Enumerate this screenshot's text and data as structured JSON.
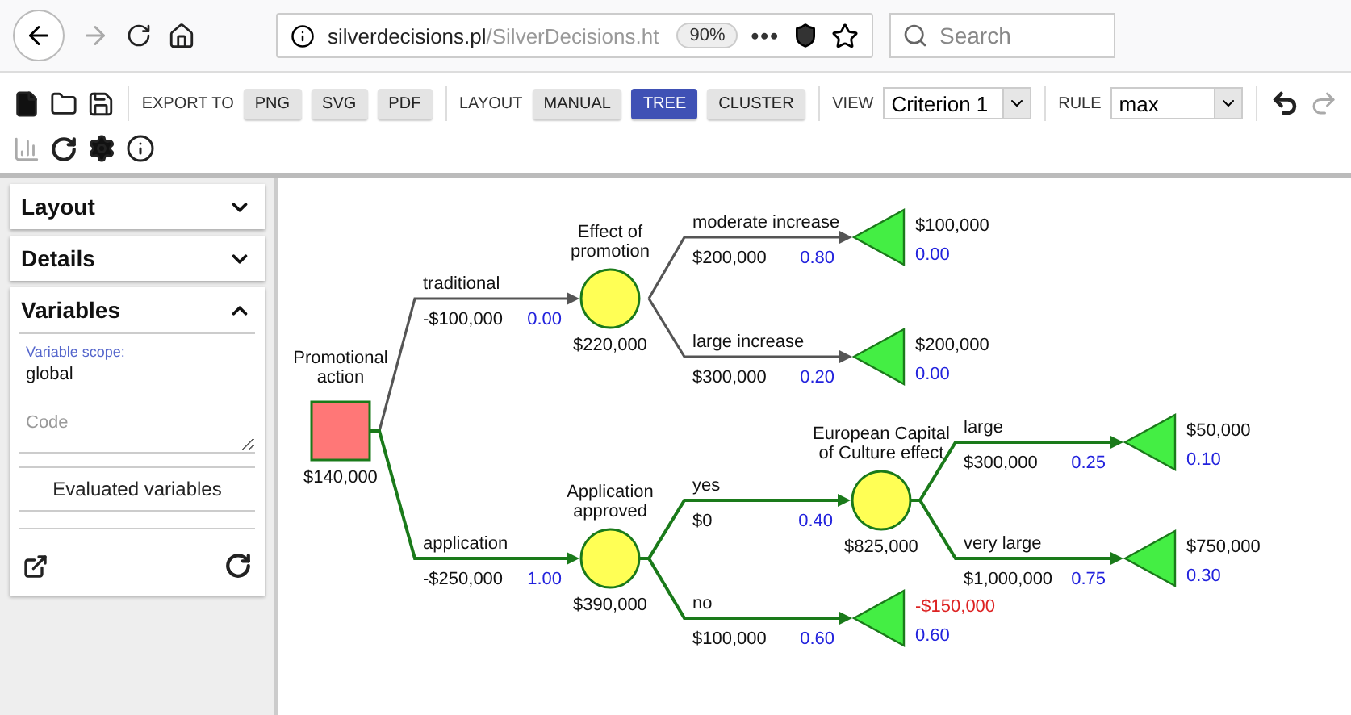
{
  "browser": {
    "url_domain": "silverdecisions.pl",
    "url_path": "/SilverDecisions.ht",
    "zoom": "90%",
    "menu": "•••",
    "search_placeholder": "Search"
  },
  "toolbar": {
    "export_label": "EXPORT TO",
    "export_buttons": [
      "PNG",
      "SVG",
      "PDF"
    ],
    "layout_label": "LAYOUT",
    "layout_buttons": [
      {
        "label": "MANUAL",
        "selected": false
      },
      {
        "label": "TREE",
        "selected": true
      },
      {
        "label": "CLUSTER",
        "selected": false
      }
    ],
    "view_label": "VIEW",
    "view_value": "Criterion 1",
    "rule_label": "RULE",
    "rule_value": "max",
    "undo": {
      "disabled": false
    },
    "redo": {
      "disabled": true
    },
    "chart": {
      "disabled": true
    }
  },
  "sidebar": {
    "panels": [
      {
        "title": "Layout",
        "expanded": false
      },
      {
        "title": "Details",
        "expanded": false
      },
      {
        "title": "Variables",
        "expanded": true
      }
    ],
    "variable_scope_label": "Variable scope:",
    "variable_scope_value": "global",
    "code_placeholder": "Code",
    "evaluated_button": "Evaluated variables"
  },
  "tree": {
    "kind": "decision",
    "label": [
      "Promotional",
      "action"
    ],
    "value": "$140,000",
    "children": [
      {
        "kind": "chance",
        "label": [
          "Effect of",
          "promotion"
        ],
        "value": "$220,000",
        "branch": {
          "label": "traditional",
          "payoff": "-$100,000",
          "probability": "0.00",
          "optimal": false
        },
        "children": [
          {
            "kind": "terminal",
            "payoff": "$100,000",
            "probability": "0.00",
            "negative": false,
            "branch": {
              "label": "moderate increase",
              "payoff": "$200,000",
              "probability": "0.80",
              "optimal": false
            }
          },
          {
            "kind": "terminal",
            "payoff": "$200,000",
            "probability": "0.00",
            "negative": false,
            "branch": {
              "label": "large increase",
              "payoff": "$300,000",
              "probability": "0.20",
              "optimal": false
            }
          }
        ]
      },
      {
        "kind": "chance",
        "label": [
          "Application",
          "approved"
        ],
        "value": "$390,000",
        "branch": {
          "label": "application",
          "payoff": "-$250,000",
          "probability": "1.00",
          "optimal": true
        },
        "children": [
          {
            "kind": "chance",
            "label": [
              "European Capital",
              "of Culture effect"
            ],
            "value": "$825,000",
            "branch": {
              "label": "yes",
              "payoff": "$0",
              "probability": "0.40",
              "optimal": true
            },
            "children": [
              {
                "kind": "terminal",
                "payoff": "$50,000",
                "probability": "0.10",
                "negative": false,
                "branch": {
                  "label": "large",
                  "payoff": "$300,000",
                  "probability": "0.25",
                  "optimal": true
                }
              },
              {
                "kind": "terminal",
                "payoff": "$750,000",
                "probability": "0.30",
                "negative": false,
                "branch": {
                  "label": "very large",
                  "payoff": "$1,000,000",
                  "probability": "0.75",
                  "optimal": true
                }
              }
            ]
          },
          {
            "kind": "terminal",
            "payoff": "-$150,000",
            "probability": "0.60",
            "negative": true,
            "branch": {
              "label": "no",
              "payoff": "$100,000",
              "probability": "0.60",
              "optimal": true
            }
          }
        ]
      }
    ]
  }
}
